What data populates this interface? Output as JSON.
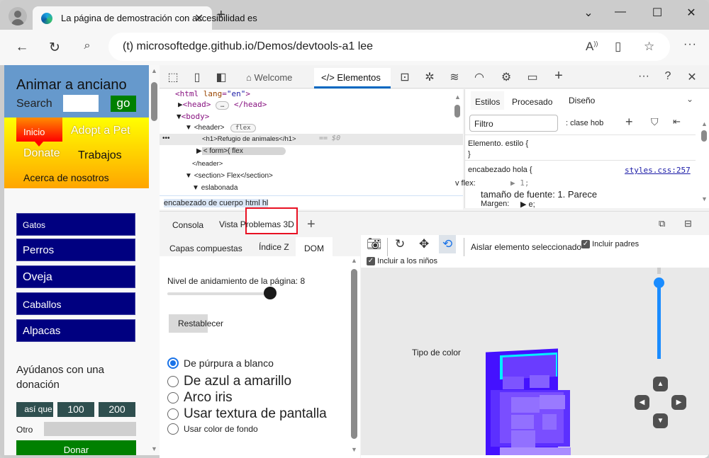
{
  "browser": {
    "tab_title": "La página de demostración con accesibilidad es",
    "url": "(t) microsoftedge.github.io/Demos/devtools-a1 lee",
    "window_controls": [
      "chevron-down",
      "minimize",
      "maximize",
      "close"
    ]
  },
  "page": {
    "heading": "Animar a anciano",
    "search_label": "Search",
    "search_value": "",
    "go_label": "go",
    "nav": {
      "inicio": "Inicio",
      "adopt": "Adopt a Pet",
      "donate": "Donate",
      "trabajos": "Trabajos",
      "about": "Acerca de nosotros"
    },
    "animals": [
      "Gatos",
      "Perros",
      "Oveja",
      "Caballos",
      "Alpacas"
    ],
    "donation": {
      "heading": "Ayúdanos con una donación",
      "amounts": [
        "así que",
        "100",
        "200"
      ],
      "other_label": "Otro",
      "other_value": "",
      "donate_button": "Donar"
    }
  },
  "devtools": {
    "top_tabs": {
      "welcome": "Welcome",
      "elements": "Elementos"
    },
    "dom": {
      "html": "<html lang=\"en\">",
      "html_tag": "html",
      "lang_attr": "lang",
      "lang_val": "\"en\"",
      "head": "<head>",
      "head_close": "</head>",
      "body": "<body>",
      "header": "<header>",
      "flex_pill": "flex",
      "h1": "<h1>Refugio de animales</h1>",
      "selected_marker": "== $0",
      "form": "< form>( flex",
      "header_close": "</header>",
      "section": "<section> Flex</section>",
      "eslabonada": "eslabonada"
    },
    "breadcrumb": "encabezado de cuerpo html hl",
    "styles": {
      "tabs": [
        "Estilos",
        "Procesado",
        "Diseño"
      ],
      "filter_placeholder": "Filtro",
      "hov_cls": ": clase hob",
      "element_style": "Elemento. estilo {",
      "close_brace": "}",
      "selector": "encabezado hola {",
      "source_link": "styles.css:257",
      "flex_prop": "v flex:",
      "flex_val": "1;",
      "font_size_prop": "tamaño de fuente: 1. Parece",
      "margin_prop": "Margen:",
      "margin_val": "e;"
    },
    "drawer": {
      "tabs": [
        "Consola",
        "Vista Problemas 3D"
      ],
      "sub_tabs": [
        "Capas compuestas",
        "Índice Z",
        "DOM"
      ],
      "nesting_label": "Nivel de anidamiento de la página: 8",
      "nesting_level": 8,
      "nesting_max": 9,
      "reset_button": "Restablecer",
      "color_options": [
        {
          "label": "De púrpura a blanco",
          "checked": true
        },
        {
          "label": "De azul a amarillo",
          "checked": false
        },
        {
          "label": "Arco iris",
          "checked": false
        },
        {
          "label": "Usar textura de pantalla",
          "checked": false
        },
        {
          "label": "Usar color de fondo",
          "checked": false
        }
      ],
      "isolate_label": "Aislar elemento seleccionado",
      "include_parents": "Incluir padres",
      "include_parents_checked": true,
      "include_children": "Incluir a los niños",
      "include_children_checked": true,
      "color_type_label": "Tipo de color",
      "zoom_level_percent": 90
    }
  },
  "colors": {
    "accent": "#0067c0",
    "header_blue": "#6699cc",
    "animal_navy": "#000080",
    "go_green": "#008000",
    "highlight_red": "#e81123",
    "slider_blue": "#1a8cff"
  }
}
